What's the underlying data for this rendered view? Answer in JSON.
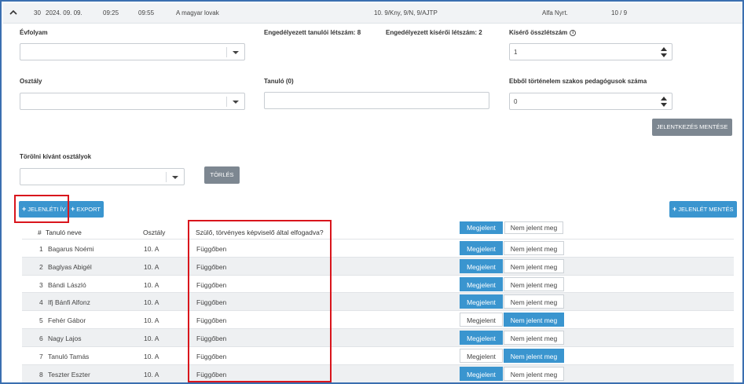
{
  "summary": {
    "count": "30",
    "date": "2024. 09. 09.",
    "start": "09:25",
    "end": "09:55",
    "title": "A magyar lovak",
    "classes": "10. 9/Kny, 9/N, 9/AJTP",
    "provider": "Alfa Nyrt.",
    "ratio": "10 / 9"
  },
  "form": {
    "evfolyam_label": "Évfolyam",
    "allowed_students": "Engedélyezett tanulói létszám: 8",
    "allowed_escorts": "Engedélyezett kísérői létszám: 2",
    "escort_total_label": "Kísérő összlétszám",
    "escort_total_value": "1",
    "osztaly_label": "Osztály",
    "tanulo_label": "Tanuló (0)",
    "history_label": "Ebből történelem szakos pedagógusok száma",
    "history_value": "0",
    "save_registration": "JELENTKEZÉS MENTÉSE",
    "delete_classes_label": "Törölni kívánt osztályok",
    "delete_button": "TÖRLÉS"
  },
  "toolbar": {
    "attendance_sheet": "JELENLÉTI ÍV",
    "export": "EXPORT",
    "attendance_save": "JELENLÉT MENTÉS"
  },
  "table": {
    "headers": {
      "num": "#",
      "name": "Tanuló neve",
      "class": "Osztály",
      "consent": "Szülő, törvényes képviselő által elfogadva?"
    },
    "header_toggle": {
      "present": "Megjelent",
      "absent": "Nem jelent meg"
    },
    "rows": [
      {
        "num": "1",
        "name": "Bagarus Noémi",
        "class": "10. A",
        "consent": "Függőben",
        "status": "present"
      },
      {
        "num": "2",
        "name": "Baglyas Abigél",
        "class": "10. A",
        "consent": "Függőben",
        "status": "present"
      },
      {
        "num": "3",
        "name": "Bándi László",
        "class": "10. A",
        "consent": "Függőben",
        "status": "present"
      },
      {
        "num": "4",
        "name": "Ifj Bánfi Alfonz",
        "class": "10. A",
        "consent": "Függőben",
        "status": "present"
      },
      {
        "num": "5",
        "name": "Fehér Gábor",
        "class": "10. A",
        "consent": "Függőben",
        "status": "absent"
      },
      {
        "num": "6",
        "name": "Nagy Lajos",
        "class": "10. A",
        "consent": "Függőben",
        "status": "present"
      },
      {
        "num": "7",
        "name": "Tanuló Tamás",
        "class": "10. A",
        "consent": "Függőben",
        "status": "absent"
      },
      {
        "num": "8",
        "name": "Teszter Eszter",
        "class": "10. A",
        "consent": "Függőben",
        "status": "present"
      }
    ]
  },
  "colors": {
    "accent": "#3a95cf",
    "highlight": "#d9151c",
    "gray_button": "#7d8791"
  }
}
